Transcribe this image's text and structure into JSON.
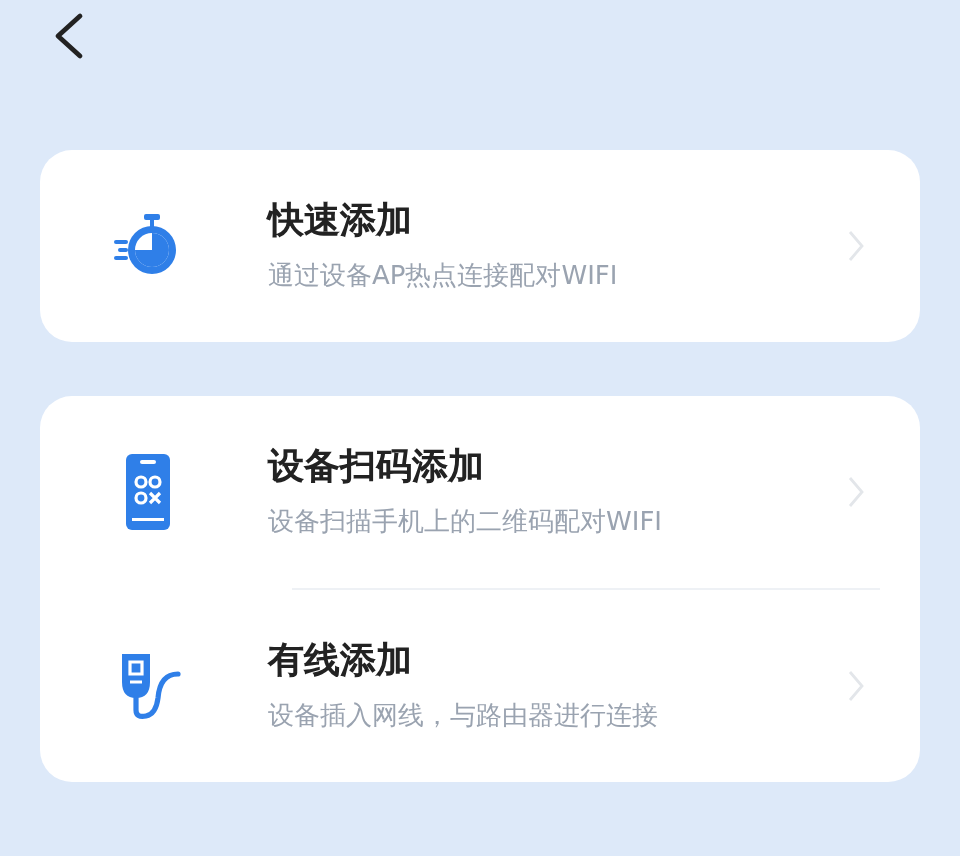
{
  "cards": [
    {
      "items": [
        {
          "kind": "stopwatch",
          "title": "快速添加",
          "subtitle": "通过设备AP热点连接配对WIFI"
        }
      ]
    },
    {
      "items": [
        {
          "kind": "phone",
          "title": "设备扫码添加",
          "subtitle": "设备扫描手机上的二维码配对WIFI"
        },
        {
          "kind": "cable",
          "title": "有线添加",
          "subtitle": "设备插入网线，与路由器进行连接"
        }
      ]
    }
  ]
}
